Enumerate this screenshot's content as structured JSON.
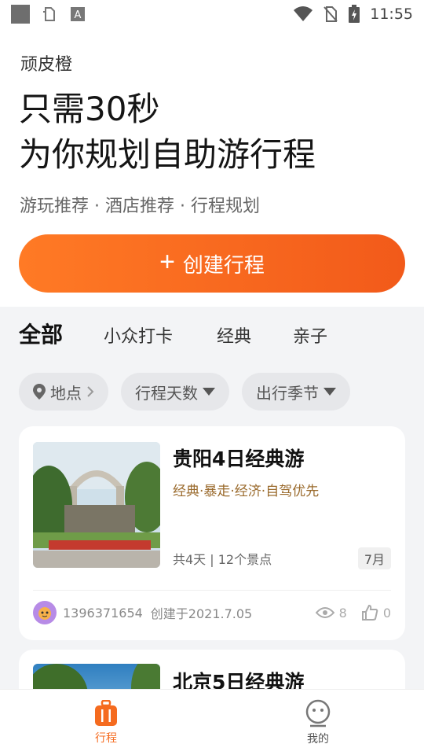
{
  "status_bar": {
    "time": "11:55",
    "icons": [
      "square-icon",
      "file-icon",
      "a-icon",
      "wifi-icon",
      "no-sim-icon",
      "battery-charging-icon"
    ]
  },
  "hero": {
    "brand": "顽皮橙",
    "headline_line1": "只需30秒",
    "headline_line2": "为你规划自助游行程",
    "subline": "游玩推荐 · 酒店推荐 · 行程规划",
    "cta_label": "创建行程"
  },
  "category_tabs": [
    {
      "label": "全部",
      "active": true
    },
    {
      "label": "小众打卡",
      "active": false
    },
    {
      "label": "经典",
      "active": false
    },
    {
      "label": "亲子",
      "active": false
    }
  ],
  "filters": [
    {
      "label": "地点",
      "icon": "location-pin-icon",
      "trailing": "chevron-right-icon"
    },
    {
      "label": "行程天数",
      "trailing": "caret-down-icon"
    },
    {
      "label": "出行季节",
      "trailing": "caret-down-icon"
    }
  ],
  "trips": [
    {
      "title": "贵阳4日经典游",
      "tags": "经典·暴走·经济·自驾优先",
      "meta": "共4天 | 12个景点",
      "month": "7月",
      "author": "1396371654",
      "created": "创建于2021.7.05",
      "views": "8",
      "likes": "0"
    },
    {
      "title": "北京5日经典游"
    }
  ],
  "bottom_nav": [
    {
      "label": "行程",
      "icon": "suitcase-icon",
      "active": true
    },
    {
      "label": "我的",
      "icon": "profile-icon",
      "active": false
    }
  ],
  "colors": {
    "accent": "#f56b1f",
    "tag_text": "#9a6a2c",
    "panel_bg": "#f3f4f6"
  }
}
